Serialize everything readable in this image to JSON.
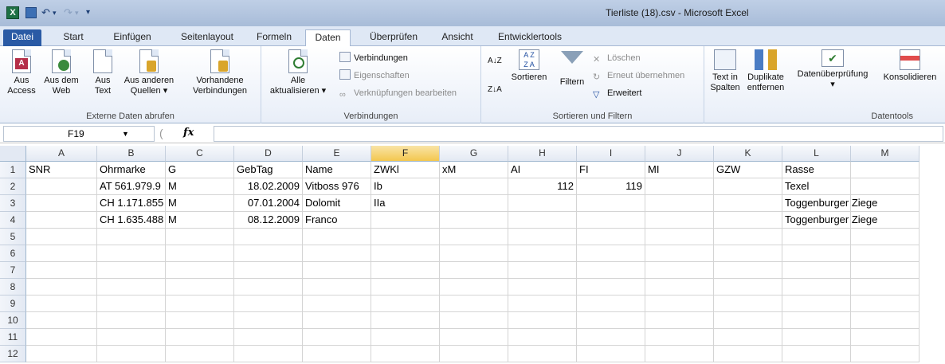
{
  "window": {
    "title": "Tierliste (18).csv  -  Microsoft Excel",
    "app_icon": "X"
  },
  "quick_access": {
    "save_icon": "floppy-icon",
    "undo_glyph": "↶",
    "redo_glyph": "↷",
    "customize_glyph": "▾"
  },
  "tabs": [
    "Datei",
    "Start",
    "Einfügen",
    "Seitenlayout",
    "Formeln",
    "Daten",
    "Überprüfen",
    "Ansicht",
    "Entwicklertools"
  ],
  "active_tab": "Daten",
  "ribbon": {
    "externe": {
      "label": "Externe Daten abrufen",
      "access": "Aus\nAccess",
      "web": "Aus dem\nWeb",
      "text": "Aus\nText",
      "andere": "Aus anderen\nQuellen ▾",
      "vorhandene": "Vorhandene\nVerbindungen"
    },
    "verbindungen": {
      "label": "Verbindungen",
      "alle": "Alle\naktualisieren ▾",
      "verbindungen": "Verbindungen",
      "eigenschaften": "Eigenschaften",
      "verknuepfungen": "Verknüpfungen bearbeiten"
    },
    "sortieren": {
      "label": "Sortieren und Filtern",
      "az": "A↓Z",
      "za": "Z↓A",
      "sortieren": "Sortieren",
      "filtern": "Filtern",
      "loeschen": "Löschen",
      "erneut": "Erneut übernehmen",
      "erweitert": "Erweitert"
    },
    "datentools": {
      "label": "Datentools",
      "textinspalten": "Text in\nSpalten",
      "duplikate": "Duplikate\nentfernen",
      "datenueberpruefung": "Datenüberprüfung\n▾",
      "konsolidieren": "Konsolidieren"
    }
  },
  "formula_bar": {
    "name_box": "F19",
    "fx": "fx",
    "formula": ""
  },
  "columns": [
    "A",
    "B",
    "C",
    "D",
    "E",
    "F",
    "G",
    "H",
    "I",
    "J",
    "K",
    "L",
    "M"
  ],
  "selected_column": "F",
  "rows": [
    [
      "SNR",
      "Ohrmarke",
      "G",
      "GebTag",
      "Name",
      "ZWKl",
      "xM",
      "AI",
      "FI",
      "MI",
      "GZW",
      "Rasse",
      ""
    ],
    [
      "",
      "AT 561.979.9",
      "M",
      "18.02.2009",
      "Vitboss 976",
      "Ib",
      "",
      "112",
      "119",
      "",
      "",
      "Texel",
      ""
    ],
    [
      "",
      "CH 1.171.855",
      "M",
      "07.01.2004",
      "Dolomit",
      "IIa",
      "",
      "",
      "",
      "",
      "",
      "Toggenburger Ziege",
      ""
    ],
    [
      "",
      "CH 1.635.488",
      "M",
      "08.12.2009",
      "Franco",
      "",
      "",
      "",
      "",
      "",
      "",
      "Toggenburger Ziege",
      ""
    ],
    [
      "",
      "",
      "",
      "",
      "",
      "",
      "",
      "",
      "",
      "",
      "",
      "",
      ""
    ],
    [
      "",
      "",
      "",
      "",
      "",
      "",
      "",
      "",
      "",
      "",
      "",
      "",
      ""
    ],
    [
      "",
      "",
      "",
      "",
      "",
      "",
      "",
      "",
      "",
      "",
      "",
      "",
      ""
    ],
    [
      "",
      "",
      "",
      "",
      "",
      "",
      "",
      "",
      "",
      "",
      "",
      "",
      ""
    ],
    [
      "",
      "",
      "",
      "",
      "",
      "",
      "",
      "",
      "",
      "",
      "",
      "",
      ""
    ],
    [
      "",
      "",
      "",
      "",
      "",
      "",
      "",
      "",
      "",
      "",
      "",
      "",
      ""
    ],
    [
      "",
      "",
      "",
      "",
      "",
      "",
      "",
      "",
      "",
      "",
      "",
      "",
      ""
    ],
    [
      "",
      "",
      "",
      "",
      "",
      "",
      "",
      "",
      "",
      "",
      "",
      "",
      ""
    ]
  ],
  "row_numbers": [
    "1",
    "2",
    "3",
    "4",
    "5",
    "6",
    "7",
    "8",
    "9",
    "10",
    "11",
    "12"
  ],
  "colors": {
    "file_tab": "#2a5aa5",
    "selected_col_header": "#f3c74f",
    "grid_line": "#d4d4d4"
  }
}
